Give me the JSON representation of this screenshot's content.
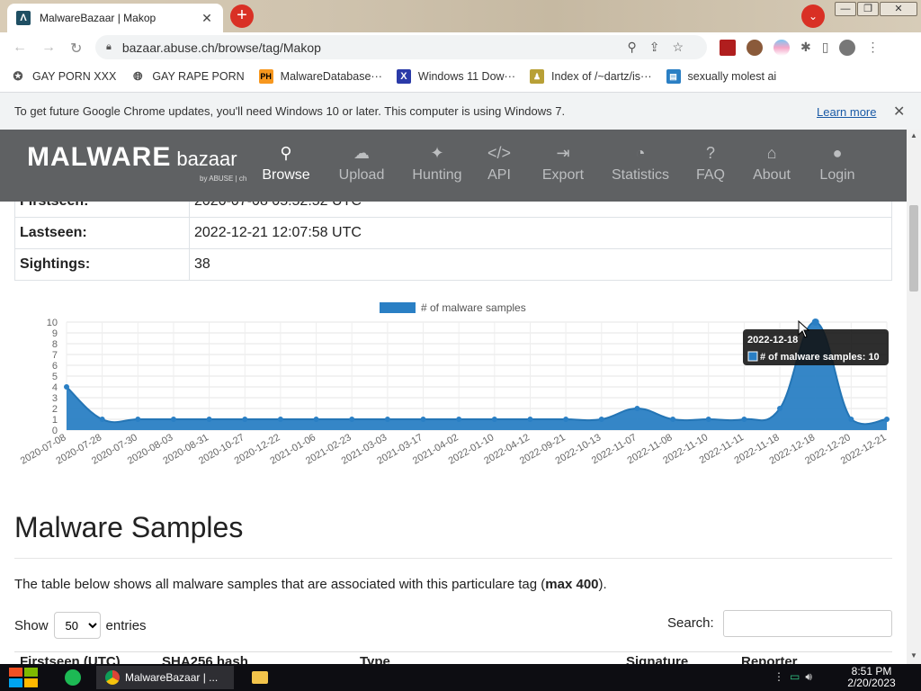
{
  "browser": {
    "tab_title": "MalwareBazaar | Makop",
    "tab_favicon_letter": "Λ",
    "url": "bazaar.abuse.ch/browse/tag/Makop",
    "bookmarks": [
      {
        "label": "GAY PORN XXX",
        "icon": "puzzle-icon"
      },
      {
        "label": "GAY RAPE PORN",
        "icon": "globe-icon"
      },
      {
        "label": "MalwareDatabase···",
        "icon": "ph-logo-icon"
      },
      {
        "label": "Windows 11 Dow···",
        "icon": "x-logo-icon"
      },
      {
        "label": "Index of /~dartz/is···",
        "icon": "folder-person-icon"
      },
      {
        "label": "sexually molest ai",
        "icon": "doc-icon"
      }
    ],
    "infobar_text": "To get future Google Chrome updates, you'll need Windows 10 or later. This computer is using Windows 7.",
    "infobar_link": "Learn more"
  },
  "site": {
    "logo_big": "MALWARE",
    "logo_small": "bazaar",
    "logo_by": "by ABUSE | ch",
    "nav": [
      {
        "label": "Browse",
        "icon": "search-icon",
        "glyph": "⚲",
        "active": true
      },
      {
        "label": "Upload",
        "icon": "cloud-upload-icon",
        "glyph": "☁",
        "active": false
      },
      {
        "label": "Hunting",
        "icon": "hunting-icon",
        "glyph": "✦",
        "active": false
      },
      {
        "label": "API",
        "icon": "code-icon",
        "glyph": "</>",
        "active": false
      },
      {
        "label": "Export",
        "icon": "export-icon",
        "glyph": "⇥",
        "active": false
      },
      {
        "label": "Statistics",
        "icon": "pie-chart-icon",
        "glyph": "◔",
        "active": false
      },
      {
        "label": "FAQ",
        "icon": "question-icon",
        "glyph": "?",
        "active": false
      },
      {
        "label": "About",
        "icon": "building-icon",
        "glyph": "⌂",
        "active": false
      },
      {
        "label": "Login",
        "icon": "user-icon",
        "glyph": "●",
        "active": false
      }
    ]
  },
  "info": {
    "rows": [
      {
        "key": "Firstseen:",
        "value": "2020-07-08 05:52:52 UTC"
      },
      {
        "key": "Lastseen:",
        "value": "2022-12-21 12:07:58 UTC"
      },
      {
        "key": "Sightings:",
        "value": "38"
      }
    ]
  },
  "chart_data": {
    "type": "area",
    "legend": "# of malware samples",
    "categories": [
      "2020-07-08",
      "2020-07-28",
      "2020-07-30",
      "2020-08-03",
      "2020-08-31",
      "2020-10-27",
      "2020-12-22",
      "2021-01-06",
      "2021-02-23",
      "2021-03-03",
      "2021-03-17",
      "2021-04-02",
      "2022-01-10",
      "2022-04-12",
      "2022-09-21",
      "2022-10-13",
      "2022-11-07",
      "2022-11-08",
      "2022-11-10",
      "2022-11-11",
      "2022-11-18",
      "2022-12-18",
      "2022-12-20",
      "2022-12-21"
    ],
    "values": [
      4,
      1,
      1,
      1,
      1,
      1,
      1,
      1,
      1,
      1,
      1,
      1,
      1,
      1,
      1,
      1,
      2,
      1,
      1,
      1,
      2,
      10,
      1,
      1
    ],
    "ylim": [
      0,
      10
    ],
    "yticks": [
      0,
      1,
      2,
      3,
      4,
      5,
      6,
      7,
      8,
      9,
      10
    ],
    "color": "#2a7fc4",
    "tooltip": {
      "title": "2022-12-18",
      "label": "# of malware samples: 10"
    }
  },
  "samples": {
    "heading": "Malware Samples",
    "desc_prefix": "The table below shows all malware samples that are associated with this particulare tag (",
    "desc_bold": "max 400",
    "desc_suffix": ").",
    "show_label": "Show",
    "show_value": "50",
    "entries_label": "entries",
    "search_label": "Search:",
    "columns": [
      "Firstseen (UTC)",
      "SHA256 hash",
      "Type",
      "Signature",
      "Reporter"
    ]
  },
  "taskbar": {
    "active_app": "MalwareBazaar | ...",
    "time": "8:51 PM",
    "date": "2/20/2023"
  }
}
